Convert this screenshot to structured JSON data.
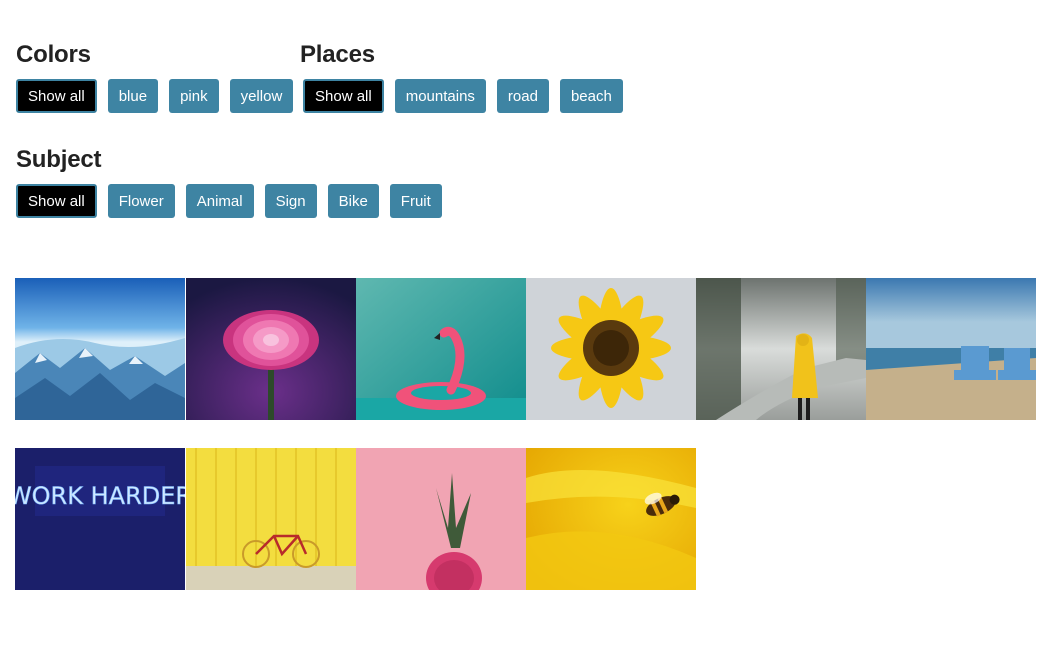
{
  "filters": {
    "colors": {
      "heading": "Colors",
      "buttons": [
        "Show all",
        "blue",
        "pink",
        "yellow"
      ]
    },
    "places": {
      "heading": "Places",
      "buttons": [
        "Show all",
        "mountains",
        "road",
        "beach"
      ]
    },
    "subject": {
      "heading": "Subject",
      "buttons": [
        "Show all",
        "Flower",
        "Animal",
        "Sign",
        "Bike",
        "Fruit"
      ]
    },
    "active_label": "Show all"
  },
  "gallery": {
    "images": [
      {
        "name": "mountains-blue"
      },
      {
        "name": "pink-dahlia"
      },
      {
        "name": "flamingo-float"
      },
      {
        "name": "sunflower"
      },
      {
        "name": "yellow-raincoat-road"
      },
      {
        "name": "beach-chairs"
      },
      {
        "name": "work-harder-neon-sign",
        "sign_text": "WORK HARDER"
      },
      {
        "name": "yellow-bike"
      },
      {
        "name": "pink-pineapple"
      },
      {
        "name": "bee-on-yellow-flower"
      }
    ]
  },
  "colors": {
    "button_bg": "#3e84a3",
    "active_bg": "#000000",
    "text": "#222222"
  }
}
